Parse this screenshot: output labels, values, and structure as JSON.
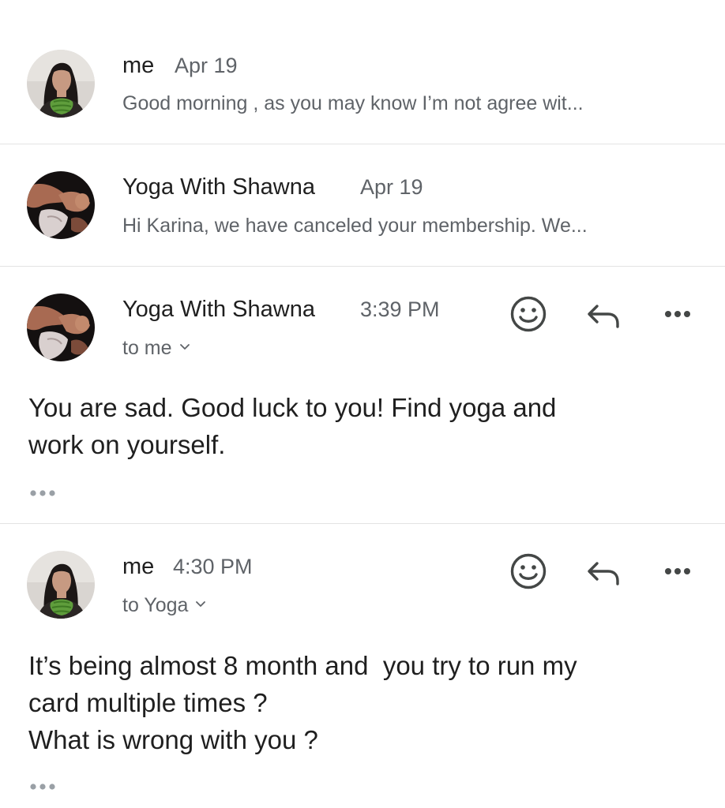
{
  "thread": {
    "messages": [
      {
        "state": "collapsed",
        "sender": "me",
        "date": "Apr 19",
        "snippet": "Good morning , as you may know I’m not agree wit..."
      },
      {
        "state": "collapsed",
        "sender": "Yoga With Shawna",
        "date": "Apr 19",
        "snippet": "Hi Karina, we have canceled your membership. We..."
      },
      {
        "state": "expanded",
        "sender": "Yoga With Shawna",
        "date": "3:39 PM",
        "recipient": "to me",
        "body_lines": [
          "You are sad. Good luck to you! Find yoga and",
          "work on yourself."
        ]
      },
      {
        "state": "expanded",
        "sender": "me",
        "date": "4:30 PM",
        "recipient": "to Yoga",
        "body_lines": [
          "It’s being almost 8 month and  you try to run my",
          "card multiple times ?",
          "What is wrong with you ?"
        ]
      }
    ]
  },
  "icons": {
    "react": "smiley-face-icon",
    "reply": "reply-arrow-icon",
    "more": "more-horizontal-icon",
    "recipient_toggle": "chevron-down-icon",
    "quoted_text": "ellipsis-dots-icon"
  },
  "colors": {
    "primary_text": "#1f1f1f",
    "secondary_text": "#5f6368",
    "icon": "#444746",
    "divider": "#e3e3e3",
    "background": "#ffffff"
  }
}
